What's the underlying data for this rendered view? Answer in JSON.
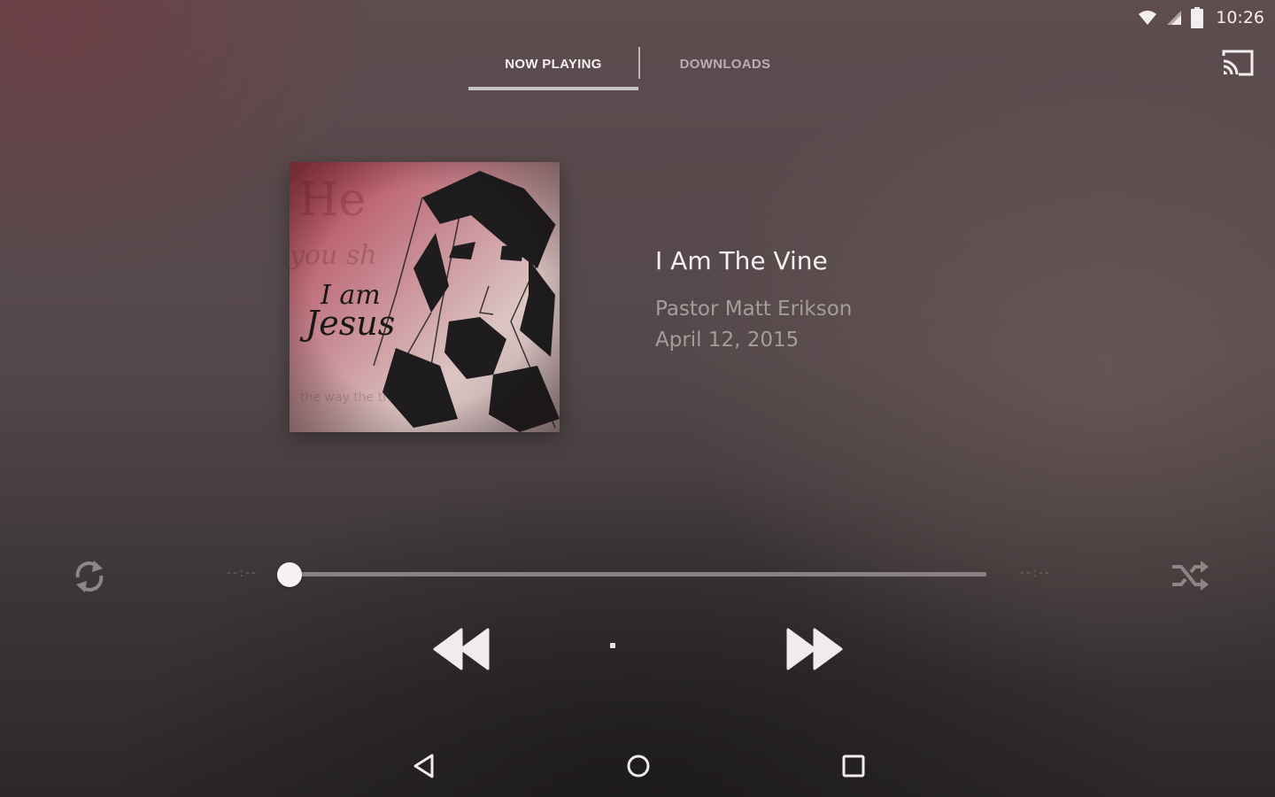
{
  "status_bar": {
    "time": "10:26",
    "icons": [
      "wifi-icon",
      "cell-signal-icon",
      "battery-icon"
    ]
  },
  "tabs": [
    {
      "label": "NOW PLAYING",
      "active": true
    },
    {
      "label": "DOWNLOADS",
      "active": false
    }
  ],
  "cast": {
    "icon": "cast-icon"
  },
  "album": {
    "icon": "album-art",
    "art_text": "I am Jesus"
  },
  "track": {
    "title": "I Am The Vine",
    "speaker": "Pastor Matt Erikson",
    "date": "April 12, 2015"
  },
  "playback": {
    "progress": 0,
    "elapsed": "--:--",
    "remaining": "--:--",
    "state": "loading"
  },
  "controls": {
    "repeat_icon": "repeat-icon",
    "shuffle_icon": "shuffle-icon",
    "rewind_icon": "rewind-icon",
    "forward_icon": "fast-forward-icon"
  },
  "nav": {
    "back_icon": "nav-back-icon",
    "home_icon": "nav-home-icon",
    "recents_icon": "nav-recents-icon"
  },
  "colors": {
    "accent": "#f4f0f0",
    "secondary_text": "#a59c9c",
    "album_red": "#b23a4c"
  }
}
